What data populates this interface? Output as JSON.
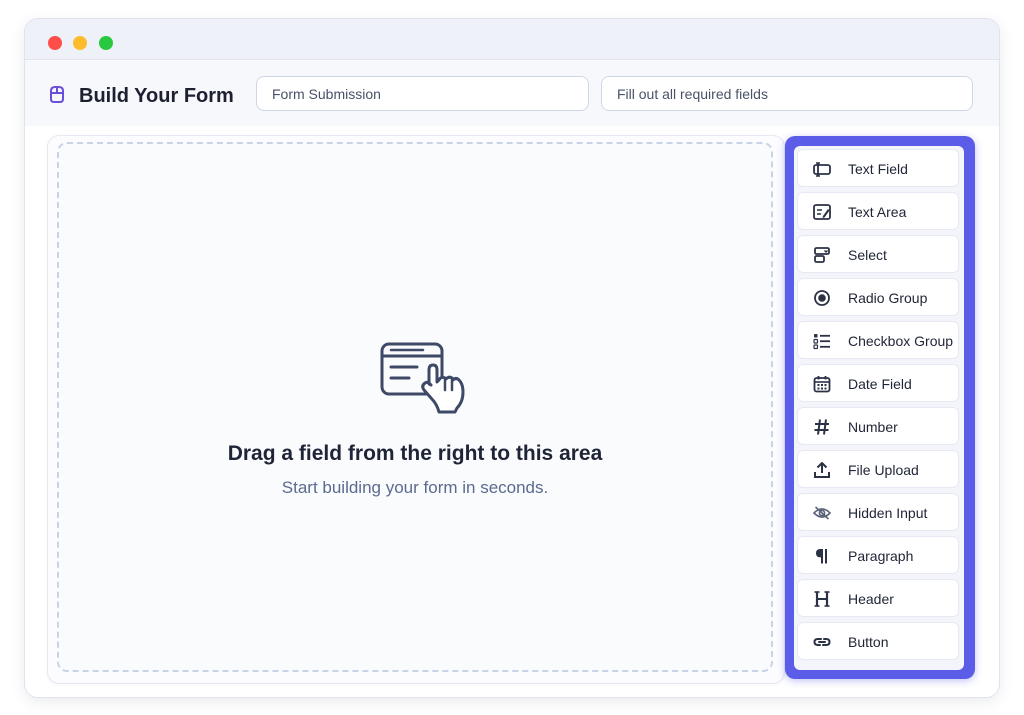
{
  "header": {
    "title": "Build Your Form",
    "form_title_value": "Form Submission",
    "form_description_value": "Fill out all required fields"
  },
  "dropzone": {
    "title": "Drag a field from the right to this area",
    "subtitle": "Start building your form in seconds."
  },
  "palette": {
    "items": [
      {
        "label": "Text Field",
        "icon": "text-field-icon"
      },
      {
        "label": "Text Area",
        "icon": "text-area-icon"
      },
      {
        "label": "Select",
        "icon": "select-icon"
      },
      {
        "label": "Radio Group",
        "icon": "radio-icon"
      },
      {
        "label": "Checkbox Group",
        "icon": "checkbox-list-icon"
      },
      {
        "label": "Date Field",
        "icon": "calendar-icon"
      },
      {
        "label": "Number",
        "icon": "hash-icon"
      },
      {
        "label": "File Upload",
        "icon": "upload-icon"
      },
      {
        "label": "Hidden Input",
        "icon": "eye-off-icon"
      },
      {
        "label": "Paragraph",
        "icon": "pilcrow-icon"
      },
      {
        "label": "Header",
        "icon": "heading-icon"
      },
      {
        "label": "Button",
        "icon": "link-icon"
      }
    ]
  },
  "colors": {
    "accent": "#5b5ce8",
    "brand_icon": "#6b4fd8"
  }
}
